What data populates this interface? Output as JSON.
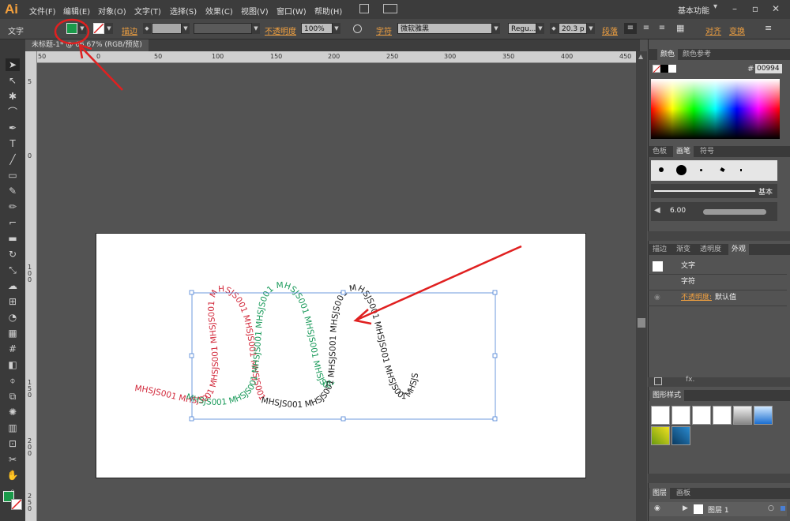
{
  "app": {
    "logo": "Ai",
    "workspace": "基本功能"
  },
  "menu": [
    "文件(F)",
    "编辑(E)",
    "对象(O)",
    "文字(T)",
    "选择(S)",
    "效果(C)",
    "视图(V)",
    "窗口(W)",
    "帮助(H)"
  ],
  "control": {
    "type_label": "文字",
    "stroke_label": "描边",
    "opacity_label": "不透明度",
    "opacity_value": "100%",
    "char_label": "字符",
    "font_family": "微软雅黑",
    "font_style": "Regu...",
    "font_size": "20.3 p",
    "para_label": "段落",
    "align_label": "对齐",
    "transform_label": "变换"
  },
  "document": {
    "tab_title": "未标题-1* @ 66.67% (RGB/预览)"
  },
  "ruler": {
    "h_ticks": [
      "50",
      "0",
      "50",
      "100",
      "150",
      "200",
      "250",
      "300",
      "350",
      "400",
      "450"
    ],
    "v_ticks": [
      "5",
      "0",
      "1 0 0",
      "1 5 0",
      "2 0 0",
      "2 5 0"
    ]
  },
  "colors": {
    "accent_red": "#e02020",
    "fill_green": "#1a9a4a",
    "text_red": "#d22a3c",
    "text_green": "#1a9a5a",
    "text_dark": "#222222"
  },
  "artwork": {
    "text_red": "MHSJS001 MHSJS001 MHSJS001 MHSJS001 MHSJS001 MHSJS001 MHSJS001",
    "text_green": "MHSJS001 MHSJS001 MHSJS001 MHSJS001 MHSJS001 MHSJS001 MHSJS001",
    "text_dark": "MHSJS001 MHSJS001 MHSJS001 MHSJS001 MHSJS001 MHSJS001 MHSJS001 MHSJS"
  },
  "panels": {
    "color": {
      "tab1": "颜色",
      "tab2": "颜色参考",
      "hex_label": "#",
      "hex_value": "00994"
    },
    "brushes": {
      "tab1": "色板",
      "tab2": "画笔",
      "tab3": "符号",
      "basic": "基本",
      "size": "6.00"
    },
    "appearance": {
      "tab1": "描边",
      "tab2": "渐变",
      "tab3": "透明度",
      "tab4": "外观",
      "row1": "文字",
      "row2": "字符",
      "row3_label": "不透明度:",
      "row3_value": "默认值"
    },
    "styles": {
      "tab1": "图形样式"
    },
    "layers": {
      "tab1": "图层",
      "tab2": "画板",
      "layer_name": "图层 1"
    }
  }
}
